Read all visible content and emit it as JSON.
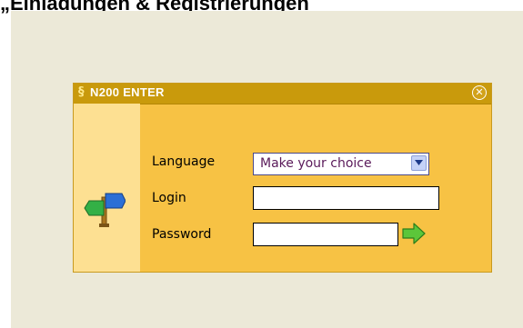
{
  "page": {
    "heading": "„Einladungen & Registrierungen"
  },
  "dialog": {
    "title": "N200 ENTER",
    "close_icon": "close-circle-x-icon",
    "side_icon": "signpost-icon",
    "fields": {
      "language_label": "Language",
      "language_value": "Make your choice",
      "login_label": "Login",
      "login_value": "",
      "password_label": "Password",
      "password_value": ""
    },
    "submit_icon": "green-arrow-right-icon"
  },
  "colors": {
    "titlebar": "#c99a0c",
    "dialog_body": "#f7c244",
    "left_panel": "#fde092",
    "stage_background": "#ece9d8",
    "submit_arrow": "#5cc63a"
  }
}
